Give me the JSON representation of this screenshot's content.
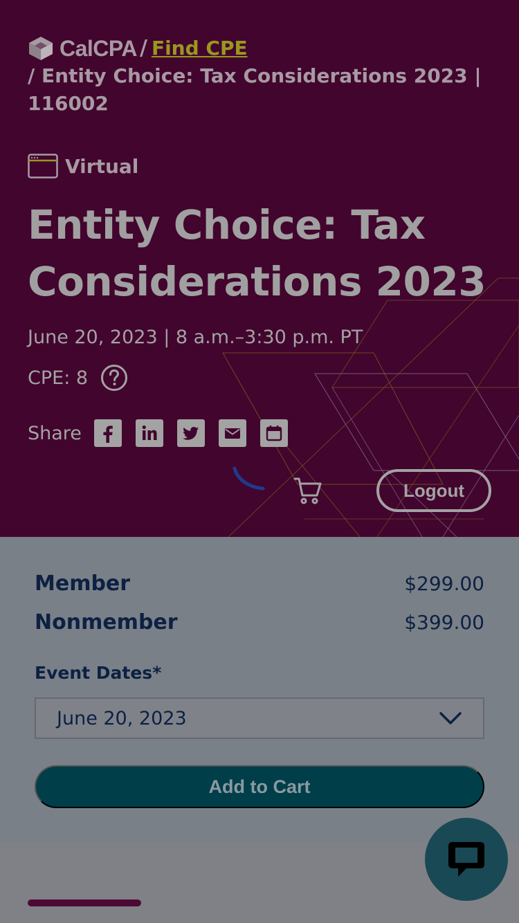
{
  "breadcrumb": {
    "logo_text": "CalCPA",
    "separator": "/",
    "find_cpe": "Find CPE",
    "current": "/ Entity Choice: Tax Considerations 2023 | 116002"
  },
  "event": {
    "format_label": "Virtual",
    "title": "Entity Choice: Tax Considerations 2023",
    "date_time": "June 20, 2023 | 8 a.m.–3:30 p.m. PT",
    "cpe": "CPE: 8"
  },
  "share": {
    "label": "Share",
    "buttons": [
      "facebook-icon",
      "linkedin-icon",
      "twitter-icon",
      "email-icon",
      "calendar-icon"
    ]
  },
  "header_actions": {
    "logout_label": "Logout"
  },
  "pricing": {
    "member_label": "Member",
    "member_price": "$299.00",
    "nonmember_label": "Nonmember",
    "nonmember_price": "$399.00"
  },
  "registration": {
    "event_dates_label": "Event Dates*",
    "selected_date": "June 20, 2023",
    "add_to_cart_label": "Add to Cart"
  },
  "colors": {
    "hero_bg": "#42052e",
    "link_accent": "#9a9720",
    "navy_text": "#0c2143",
    "cta_bg": "#003e4a",
    "chat_bg": "#194955"
  }
}
